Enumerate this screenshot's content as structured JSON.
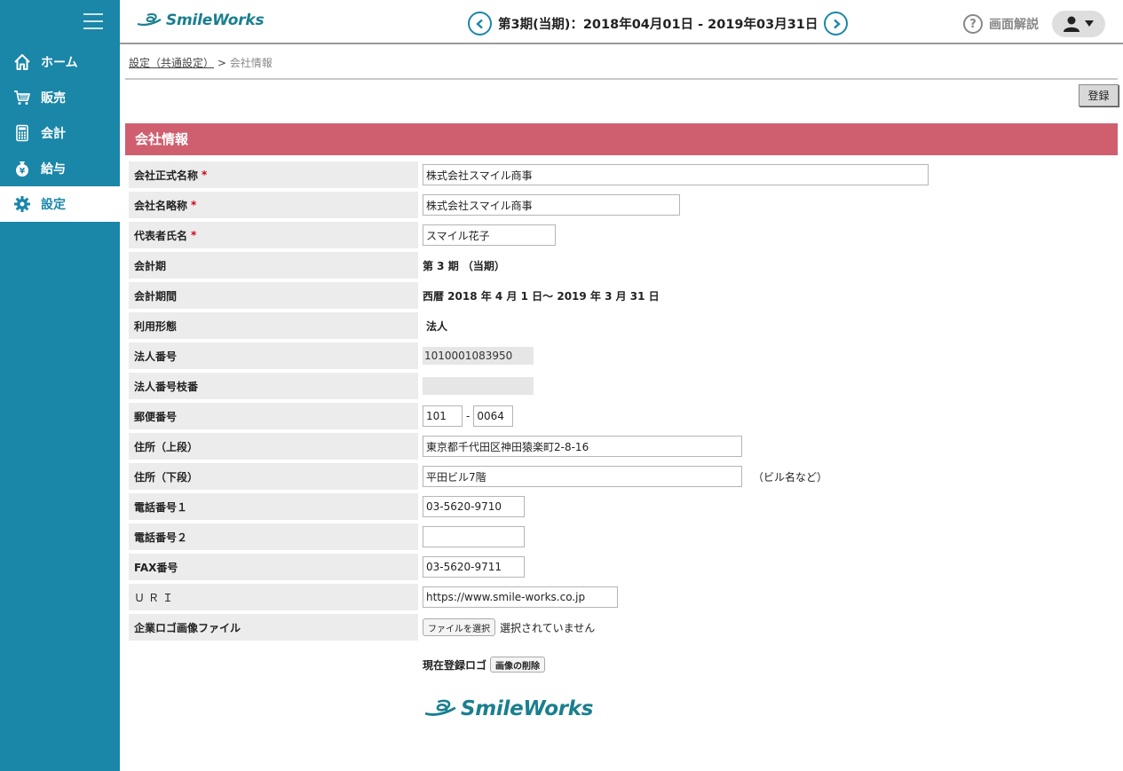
{
  "sidebar": {
    "items": [
      {
        "label": "ホーム",
        "icon": "home-icon"
      },
      {
        "label": "販売",
        "icon": "cart-icon"
      },
      {
        "label": "会計",
        "icon": "calculator-icon"
      },
      {
        "label": "給与",
        "icon": "money-bag-icon"
      },
      {
        "label": "設定",
        "icon": "gear-icon"
      }
    ]
  },
  "header": {
    "logo": "SmileWorks",
    "period": "第3期(当期)：2018年04月01日 - 2019年03月31日",
    "help": "画面解説"
  },
  "breadcrumb": {
    "parent": "設定（共通設定）",
    "separator": ">",
    "current": "会社情報"
  },
  "toolbar": {
    "register": "登録"
  },
  "section": {
    "title": "会社情報"
  },
  "form": {
    "company_name": {
      "label": "会社正式名称",
      "value": "株式会社スマイル商事"
    },
    "short_name": {
      "label": "会社名略称",
      "value": "株式会社スマイル商事"
    },
    "representative": {
      "label": "代表者氏名",
      "value": "スマイル花子"
    },
    "fiscal_term": {
      "label": "会計期",
      "value": "第 3 期 （当期）"
    },
    "fiscal_period": {
      "label": "会計期間",
      "value": "西暦 2018 年 4 月 1 日〜 2019 年 3 月 31 日"
    },
    "usage_type": {
      "label": "利用形態",
      "value": "法人"
    },
    "corp_number": {
      "label": "法人番号",
      "value": "1010001083950"
    },
    "corp_branch": {
      "label": "法人番号枝番",
      "value": ""
    },
    "postal": {
      "label": "郵便番号",
      "first": "101",
      "dash": "-",
      "second": "0064"
    },
    "address1": {
      "label": "住所（上段）",
      "value": "東京都千代田区神田猿楽町2-8-16"
    },
    "address2": {
      "label": "住所（下段）",
      "value": "平田ビル7階",
      "note": "（ビル名など）"
    },
    "phone1": {
      "label": "電話番号１",
      "value": "03-5620-9710"
    },
    "phone2": {
      "label": "電話番号２",
      "value": ""
    },
    "fax": {
      "label": "FAX番号",
      "value": "03-5620-9711"
    },
    "url": {
      "label": "ＵＲＩ",
      "value": "https://www.smile-works.co.jp"
    },
    "logo_file": {
      "label": "企業ロゴ画像ファイル",
      "button": "ファイルを選択",
      "status": "選択されていません"
    }
  },
  "current_logo": {
    "label": "現在登録ロゴ",
    "delete": "画像の削除",
    "logo": "SmileWorks"
  },
  "required_mark": "*"
}
